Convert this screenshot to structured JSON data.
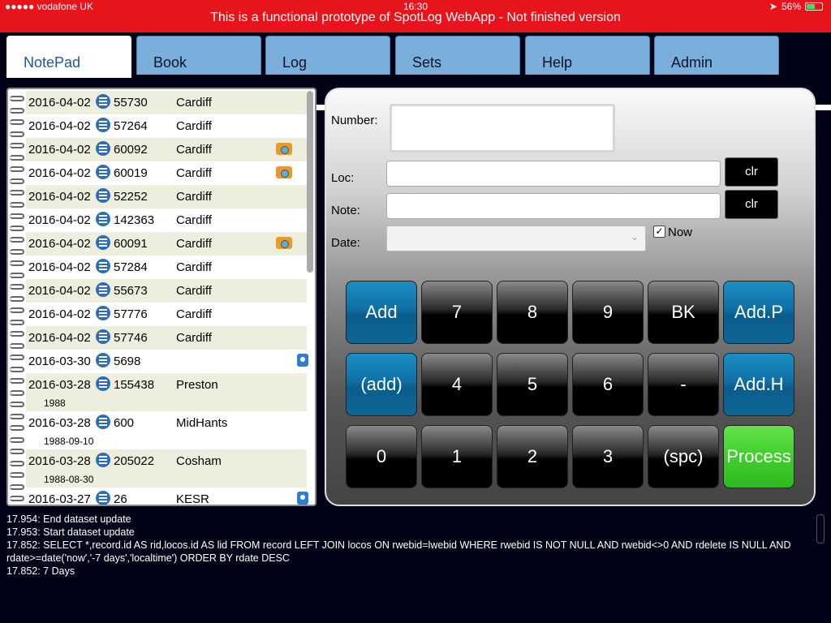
{
  "status_bar": {
    "carrier": "●●●●● vodafone UK",
    "time": "16:30",
    "battery": "56%",
    "battery_level": 0.56
  },
  "banner": "This is a functional prototype of SpotLog WebApp - Not finished version",
  "tabs": [
    {
      "label": "NotePad",
      "active": true
    },
    {
      "label": "Book",
      "active": false
    },
    {
      "label": "Log",
      "active": false
    },
    {
      "label": "Sets",
      "active": false
    },
    {
      "label": "Help",
      "active": false
    },
    {
      "label": "Admin",
      "active": false
    }
  ],
  "records": [
    {
      "date": "2016-04-02",
      "number": "55730",
      "location": "Cardiff",
      "sub": "",
      "icon": ""
    },
    {
      "date": "2016-04-02",
      "number": "57264",
      "location": "Cardiff",
      "sub": "",
      "icon": ""
    },
    {
      "date": "2016-04-02",
      "number": "60092",
      "location": "Cardiff",
      "sub": "",
      "icon": "camera-icon"
    },
    {
      "date": "2016-04-02",
      "number": "60019",
      "location": "Cardiff",
      "sub": "",
      "icon": "camera-icon"
    },
    {
      "date": "2016-04-02",
      "number": "52252",
      "location": "Cardiff",
      "sub": "",
      "icon": ""
    },
    {
      "date": "2016-04-02",
      "number": "142363",
      "location": "Cardiff",
      "sub": "",
      "icon": ""
    },
    {
      "date": "2016-04-02",
      "number": "60091",
      "location": "Cardiff",
      "sub": "",
      "icon": "camera-icon"
    },
    {
      "date": "2016-04-02",
      "number": "57284",
      "location": "Cardiff",
      "sub": "",
      "icon": ""
    },
    {
      "date": "2016-04-02",
      "number": "55673",
      "location": "Cardiff",
      "sub": "",
      "icon": ""
    },
    {
      "date": "2016-04-02",
      "number": "57776",
      "location": "Cardiff",
      "sub": "",
      "icon": ""
    },
    {
      "date": "2016-04-02",
      "number": "57746",
      "location": "Cardiff",
      "sub": "",
      "icon": ""
    },
    {
      "date": "2016-03-30",
      "number": "5698",
      "location": "",
      "sub": "",
      "icon": "lock-icon"
    },
    {
      "date": "2016-03-28",
      "number": "155438",
      "location": "Preston",
      "sub": "1988",
      "icon": ""
    },
    {
      "date": "2016-03-28",
      "number": "600",
      "location": "MidHants",
      "sub": "1988-09-10",
      "icon": ""
    },
    {
      "date": "2016-03-28",
      "number": "205022",
      "location": "Cosham",
      "sub": "1988-08-30",
      "icon": ""
    },
    {
      "date": "2016-03-27",
      "number": "26",
      "location": "KESR",
      "sub": "",
      "icon": "lock-icon"
    }
  ],
  "form": {
    "number_label": "Number:",
    "number_value": "",
    "loc_label": "Loc:",
    "loc_value": "",
    "note_label": "Note:",
    "note_value": "",
    "date_label": "Date:",
    "date_value": "",
    "clr_label": "clr",
    "now_label": "Now",
    "now_checked": true,
    "check_mark": "✓",
    "chevron": "⌄"
  },
  "keypad": [
    [
      "Add",
      "7",
      "8",
      "9",
      "BK",
      "Add.P"
    ],
    [
      "(add)",
      "4",
      "5",
      "6",
      "-",
      "Add.H"
    ],
    [
      "0",
      "1",
      "2",
      "3",
      "(spc)",
      "Process"
    ]
  ],
  "colors": {
    "banner_bg": "#e8141b",
    "tab_bg": "#7aafdc",
    "key_blue": "#0f6fa3",
    "key_green": "#3fcf2c",
    "row_alt": "#eeeedf"
  },
  "console_lines": [
    "17.954: End dataset update",
    "17.953: Start dataset update",
    "17.852: SELECT *,record.id AS rid,locos.id AS lid FROM record LEFT JOIN locos ON rwebid=lwebid WHERE rwebid IS NOT NULL AND rwebid<>0 AND rdelete IS NULL AND rdate>=date('now','-7 days','localtime') ORDER BY rdate DESC",
    "17.852: 7 Days"
  ]
}
